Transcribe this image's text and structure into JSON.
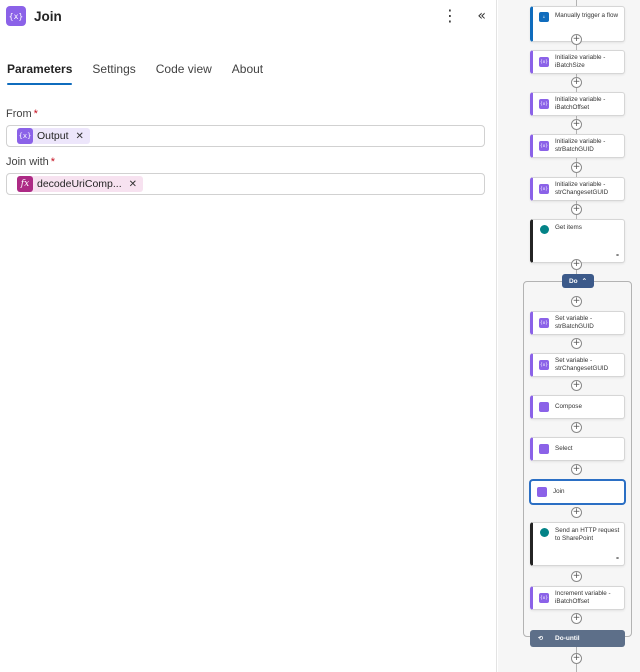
{
  "panel": {
    "title": "Join",
    "icon": "variable-icon",
    "tabs": [
      {
        "label": "Parameters",
        "active": true
      },
      {
        "label": "Settings",
        "active": false
      },
      {
        "label": "Code view",
        "active": false
      },
      {
        "label": "About",
        "active": false
      }
    ],
    "fields": {
      "from": {
        "label": "From",
        "required_mark": "*",
        "token": "Output"
      },
      "join_with": {
        "label": "Join with",
        "required_mark": "*",
        "token": "decodeUriComp..."
      }
    }
  },
  "flow": {
    "trigger": "Manually trigger a flow",
    "steps": [
      "Initialize variable - iBatchSize",
      "Initialize variable - iBatchOffset",
      "Initialize variable - strBatchGUID",
      "Initialize variable - strChangesetGUID",
      "Get items"
    ],
    "loop_label": "Do",
    "loop_steps": [
      "Set variable - strBatchGUID",
      "Set variable - strChangesetGUID",
      "Compose",
      "Select",
      "Join",
      "Send an HTTP request to SharePoint",
      "Increment variable - iBatchOffset"
    ],
    "loop_end_label": "Do-until",
    "selected_step": "Join"
  },
  "colors": {
    "accent": "#0f6cbd",
    "variable": "#8b62e8",
    "expression": "#ad2a85",
    "sharepoint": "#038387",
    "loop": "#3c5a8a"
  }
}
